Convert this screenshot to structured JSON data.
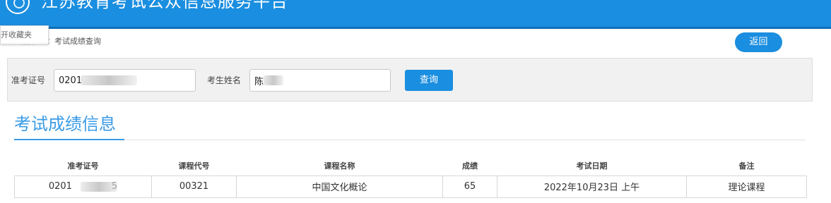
{
  "header": {
    "site_title": "江苏教育考试公众信息服务平台"
  },
  "bookmark_popup": {
    "label": "开收藏夹"
  },
  "breadcrumb": {
    "text": "您的当前位置：考试成绩查询"
  },
  "back_button": {
    "label": "返回"
  },
  "search": {
    "exam_id_label": "准考证号",
    "exam_id_value": "0201",
    "name_label": "考生姓名",
    "name_value": "陈",
    "submit_label": "查询"
  },
  "section": {
    "title": "考试成绩信息"
  },
  "table": {
    "columns": [
      "准考证号",
      "课程代号",
      "课程名称",
      "成绩",
      "考试日期",
      "备注"
    ],
    "rows": [
      {
        "exam_id": "0201",
        "exam_id_tail": "5",
        "course_code": "00321",
        "course_name": "中国文化概论",
        "score": "65",
        "exam_date": "2022年10月23日 上午",
        "remark": "理论课程"
      }
    ]
  }
}
